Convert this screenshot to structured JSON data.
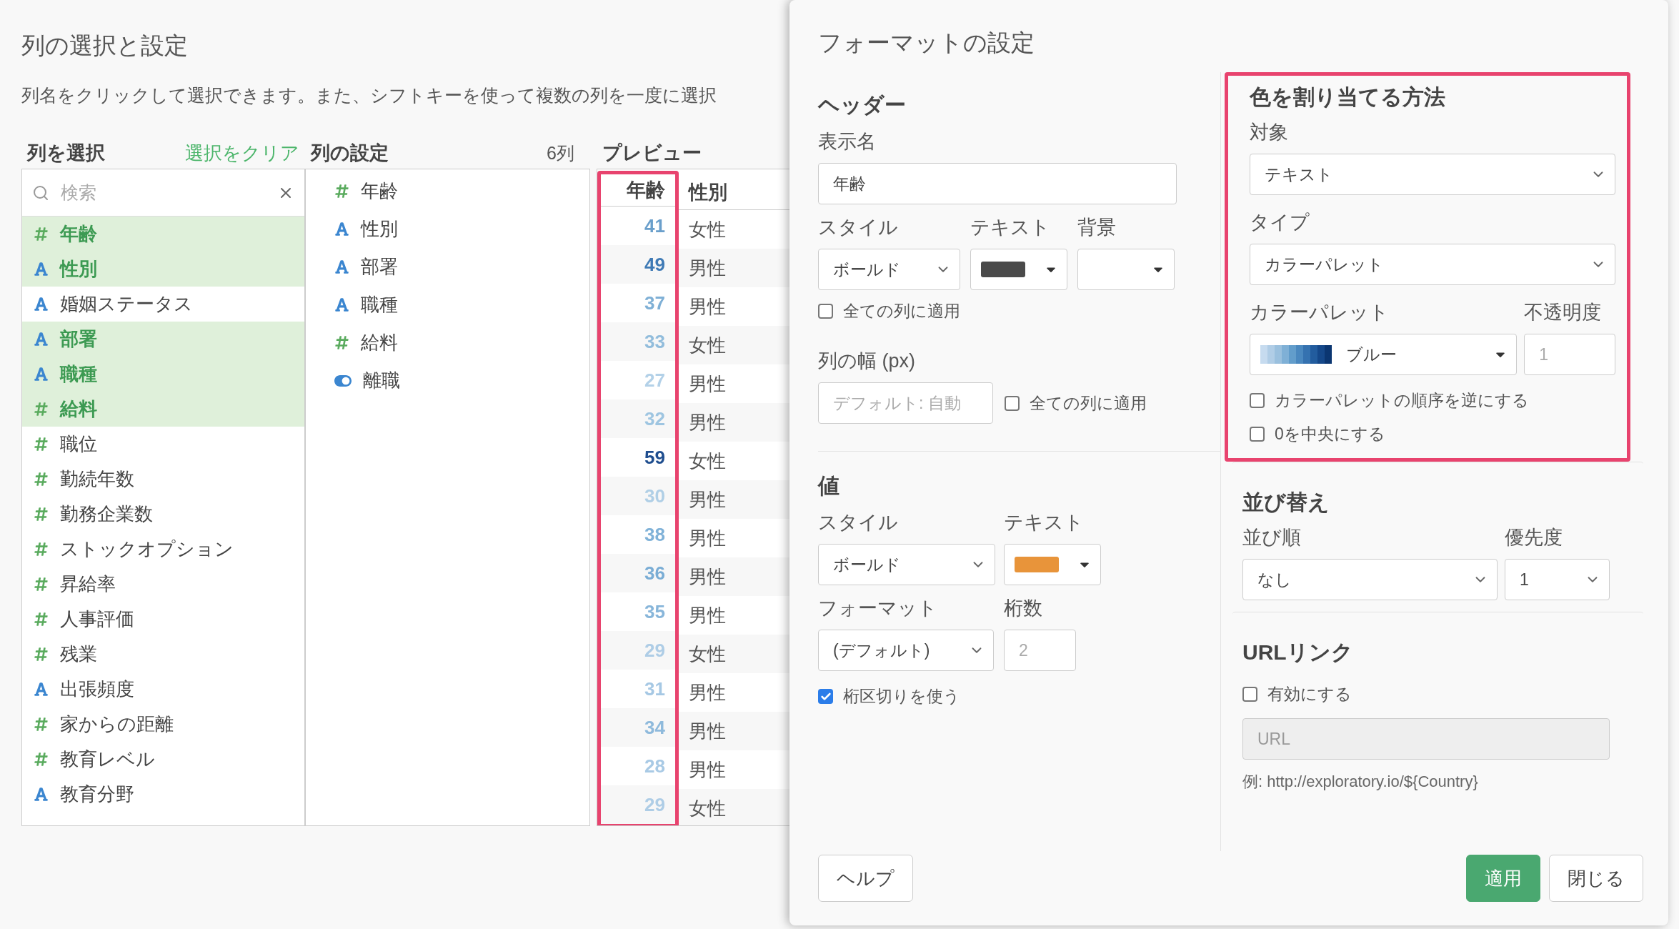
{
  "page": {
    "title": "列の選択と設定",
    "description": "列名をクリックして選択できます。また、シフトキーを使って複数の列を一度に選択"
  },
  "column_picker": {
    "heading": "列を選択",
    "clear_link": "選択をクリア",
    "search": {
      "placeholder": "検索"
    },
    "items": [
      {
        "kind": "number",
        "label": "年齢",
        "selected": true
      },
      {
        "kind": "text",
        "label": "性別",
        "selected": true
      },
      {
        "kind": "text",
        "label": "婚姻ステータス",
        "selected": false
      },
      {
        "kind": "text",
        "label": "部署",
        "selected": true
      },
      {
        "kind": "text",
        "label": "職種",
        "selected": true
      },
      {
        "kind": "number",
        "label": "給料",
        "selected": true
      },
      {
        "kind": "number",
        "label": "職位",
        "selected": false
      },
      {
        "kind": "number",
        "label": "勤続年数",
        "selected": false
      },
      {
        "kind": "number",
        "label": "勤務企業数",
        "selected": false
      },
      {
        "kind": "number",
        "label": "ストックオプション",
        "selected": false
      },
      {
        "kind": "number",
        "label": "昇給率",
        "selected": false
      },
      {
        "kind": "number",
        "label": "人事評価",
        "selected": false
      },
      {
        "kind": "number",
        "label": "残業",
        "selected": false
      },
      {
        "kind": "text",
        "label": "出張頻度",
        "selected": false
      },
      {
        "kind": "number",
        "label": "家からの距離",
        "selected": false
      },
      {
        "kind": "number",
        "label": "教育レベル",
        "selected": false
      },
      {
        "kind": "text",
        "label": "教育分野",
        "selected": false
      }
    ]
  },
  "column_settings": {
    "heading": "列の設定",
    "count": "6列",
    "items": [
      {
        "kind": "number",
        "label": "年齢"
      },
      {
        "kind": "text",
        "label": "性別"
      },
      {
        "kind": "text",
        "label": "部署"
      },
      {
        "kind": "text",
        "label": "職種"
      },
      {
        "kind": "number",
        "label": "給料"
      },
      {
        "kind": "boolean",
        "label": "離職"
      }
    ]
  },
  "preview": {
    "heading": "プレビュー",
    "columns": [
      {
        "label": "年齢",
        "highlighted": true
      },
      {
        "label": "性別",
        "highlighted": false
      }
    ],
    "rows": [
      {
        "age": "41",
        "color": "#6a9fcb",
        "gender": "女性"
      },
      {
        "age": "49",
        "color": "#3f7ab5",
        "gender": "男性"
      },
      {
        "age": "37",
        "color": "#7fb0d6",
        "gender": "男性"
      },
      {
        "age": "33",
        "color": "#92bddc",
        "gender": "女性"
      },
      {
        "age": "27",
        "color": "#b3d1e8",
        "gender": "男性"
      },
      {
        "age": "32",
        "color": "#9ec5e1",
        "gender": "男性"
      },
      {
        "age": "59",
        "color": "#1f4e8f",
        "gender": "女性"
      },
      {
        "age": "30",
        "color": "#b0cfe6",
        "gender": "男性"
      },
      {
        "age": "38",
        "color": "#80b2d8",
        "gender": "男性"
      },
      {
        "age": "36",
        "color": "#7aadd5",
        "gender": "男性"
      },
      {
        "age": "35",
        "color": "#88b6da",
        "gender": "男性"
      },
      {
        "age": "29",
        "color": "#aecde6",
        "gender": "女性"
      },
      {
        "age": "31",
        "color": "#a6c8e4",
        "gender": "男性"
      },
      {
        "age": "34",
        "color": "#8fbadc",
        "gender": "男性"
      },
      {
        "age": "28",
        "color": "#a9cae5",
        "gender": "男性"
      },
      {
        "age": "29",
        "color": "#aecde6",
        "gender": "女性"
      }
    ]
  },
  "format_dialog": {
    "title": "フォーマットの設定",
    "header": {
      "heading": "ヘッダー",
      "display_name": {
        "label": "表示名",
        "value": "年齢"
      },
      "style": {
        "label": "スタイル",
        "value": "ボールド"
      },
      "text_color": {
        "label": "テキスト",
        "color": "#4a4a4a"
      },
      "background": {
        "label": "背景"
      },
      "apply_all": {
        "label": "全ての列に適用",
        "checked": false
      },
      "width": {
        "label": "列の幅 (px)",
        "placeholder": "デフォルト: 自動"
      },
      "width_apply_all": {
        "label": "全ての列に適用",
        "checked": false
      }
    },
    "values": {
      "heading": "値",
      "style": {
        "label": "スタイル",
        "value": "ボールド"
      },
      "text_color": {
        "label": "テキスト",
        "color": "#e8943a"
      },
      "format": {
        "label": "フォーマット",
        "value": "(デフォルト)"
      },
      "digits": {
        "label": "桁数",
        "placeholder": "2"
      },
      "separator": {
        "label": "桁区切りを使う",
        "checked": true
      }
    },
    "color_assignment": {
      "heading": "色を割り当てる方法",
      "highlighted": true,
      "target": {
        "label": "対象",
        "value": "テキスト"
      },
      "type": {
        "label": "タイプ",
        "value": "カラーパレット"
      },
      "palette": {
        "label": "カラーパレット",
        "value": "ブルー"
      },
      "opacity": {
        "label": "不透明度",
        "placeholder": "1"
      },
      "reverse": {
        "label": "カラーパレットの順序を逆にする",
        "checked": false
      },
      "center_zero": {
        "label": "0を中央にする",
        "checked": false
      }
    },
    "sort": {
      "heading": "並び替え",
      "order": {
        "label": "並び順",
        "value": "なし"
      },
      "priority": {
        "label": "優先度",
        "value": "1"
      }
    },
    "url_link": {
      "heading": "URLリンク",
      "enable": {
        "label": "有効にする",
        "checked": false
      },
      "url": {
        "placeholder": "URL",
        "disabled": true
      },
      "example": "例: http://exploratory.io/${Country}"
    },
    "buttons": [
      {
        "kind": "help",
        "label": "ヘルプ"
      },
      {
        "kind": "primary",
        "label": "適用"
      },
      {
        "kind": "default",
        "label": "閉じる"
      }
    ]
  }
}
